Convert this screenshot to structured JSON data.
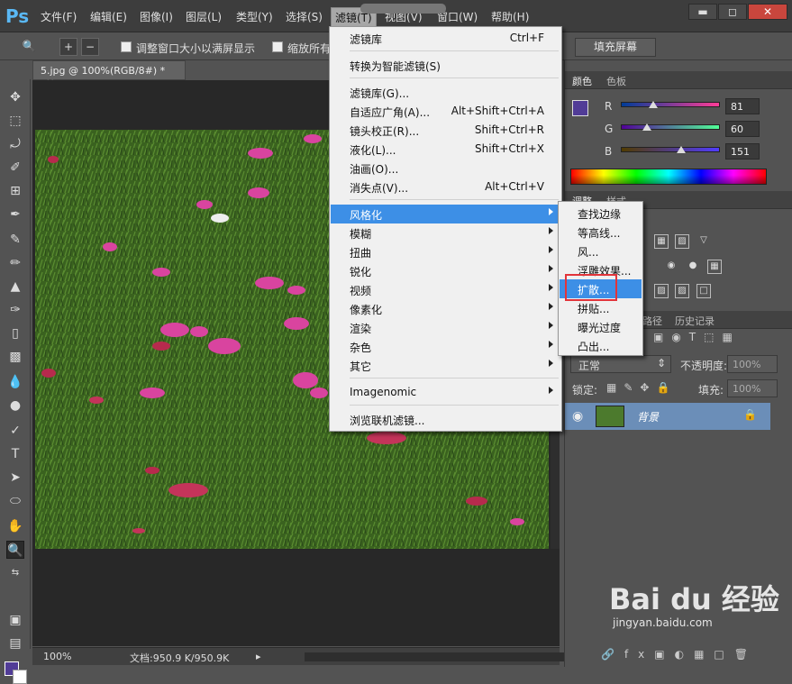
{
  "app": {
    "logo": "Ps"
  },
  "menubar": {
    "items": [
      "文件(F)",
      "编辑(E)",
      "图像(I)",
      "图层(L)",
      "类型(Y)",
      "选择(S)",
      "滤镜(T)",
      "视图(V)",
      "窗口(W)",
      "帮助(H)"
    ],
    "window_buttons": [
      "▬",
      "◻",
      "✕"
    ]
  },
  "options": {
    "resize_label": "调整窗口大小以满屏显示",
    "zoom_all_label": "缩放所有",
    "fill_screen": "填充屏幕"
  },
  "document": {
    "tab_title": "5.jpg @ 100%(RGB/8#) *",
    "tab_close": "×",
    "zoom": "100%",
    "doc_size": "文档:950.9 K/950.9K"
  },
  "filter_menu": {
    "items": [
      {
        "label": "滤镜库",
        "shortcut": "Ctrl+F"
      },
      {
        "label": "转换为智能滤镜(S)",
        "shortcut": ""
      },
      {
        "label": "滤镜库(G)...",
        "shortcut": ""
      },
      {
        "label": "自适应广角(A)...",
        "shortcut": "Alt+Shift+Ctrl+A"
      },
      {
        "label": "镜头校正(R)...",
        "shortcut": "Shift+Ctrl+R"
      },
      {
        "label": "液化(L)...",
        "shortcut": "Shift+Ctrl+X"
      },
      {
        "label": "油画(O)...",
        "shortcut": ""
      },
      {
        "label": "消失点(V)...",
        "shortcut": "Alt+Ctrl+V"
      },
      {
        "label": "风格化",
        "submenu": true
      },
      {
        "label": "模糊",
        "submenu": true
      },
      {
        "label": "扭曲",
        "submenu": true
      },
      {
        "label": "锐化",
        "submenu": true
      },
      {
        "label": "视频",
        "submenu": true
      },
      {
        "label": "像素化",
        "submenu": true
      },
      {
        "label": "渲染",
        "submenu": true
      },
      {
        "label": "杂色",
        "submenu": true
      },
      {
        "label": "其它",
        "submenu": true
      },
      {
        "label": "Imagenomic",
        "submenu": true
      },
      {
        "label": "浏览联机滤镜...",
        "shortcut": ""
      }
    ]
  },
  "stylize_submenu": {
    "items": [
      "查找边缘",
      "等高线...",
      "风...",
      "浮雕效果...",
      "扩散...",
      "拼贴...",
      "曝光过度",
      "凸出..."
    ]
  },
  "color_panel": {
    "tabs": [
      "颜色",
      "色板"
    ],
    "r_label": "R",
    "g_label": "G",
    "b_label": "B",
    "r": "81",
    "g": "60",
    "b": "151",
    "fg_color": "#513c97"
  },
  "adjust_panel": {
    "tabs": [
      "调整",
      "样式"
    ]
  },
  "layers_panel": {
    "tabs": [
      "路径",
      "历史记录"
    ],
    "blend_mode": "正常",
    "opacity_label": "不透明度:",
    "opacity": "100%",
    "lock_label": "锁定:",
    "fill_label": "填充:",
    "fill": "100%",
    "layer_name": "背景"
  },
  "watermark": {
    "logo": "Bai du 经验",
    "url": "jingyan.baidu.com"
  }
}
